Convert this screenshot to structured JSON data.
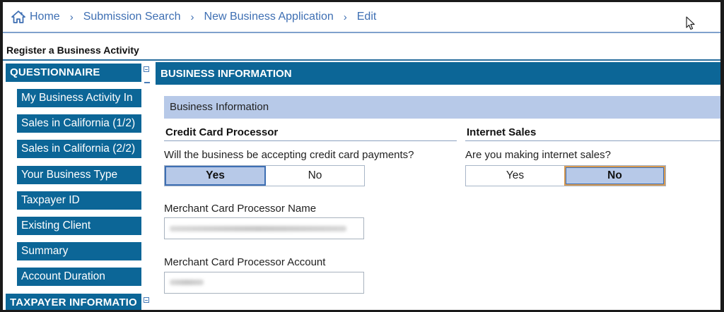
{
  "breadcrumb": {
    "items": [
      "Home",
      "Submission Search",
      "New Business Application",
      "Edit"
    ],
    "separator": "›"
  },
  "page_title": "Register a Business Activity",
  "sidebar": {
    "header": "QUESTIONNAIRE",
    "items": [
      "My Business Activity In",
      "Sales in California (1/2)",
      "Sales in California (2/2)",
      "Your Business Type",
      "Taxpayer ID",
      "Existing Client",
      "Summary",
      "Account Duration"
    ],
    "second_header": "TAXPAYER INFORMATIO"
  },
  "main": {
    "header": "BUSINESS INFORMATION",
    "section": "Business Information",
    "credit_card": {
      "title": "Credit Card Processor",
      "question": "Will the business be accepting credit card payments?",
      "options": [
        "Yes",
        "No"
      ],
      "selected": "Yes"
    },
    "internet_sales": {
      "title": "Internet Sales",
      "question": "Are you making internet sales?",
      "options": [
        "Yes",
        "No"
      ],
      "selected": "No"
    },
    "processor_name": {
      "label": "Merchant Card Processor Name",
      "value": ""
    },
    "processor_account": {
      "label": "Merchant Card Processor Account",
      "value": ""
    }
  },
  "colors": {
    "brand_blue": "#0c6697",
    "link_blue": "#3e6fb3",
    "section_bg": "#b7c9e8",
    "selected_focus": "#d79a52"
  },
  "icons": [
    "home-icon",
    "cursor-icon",
    "collapse-icon"
  ]
}
